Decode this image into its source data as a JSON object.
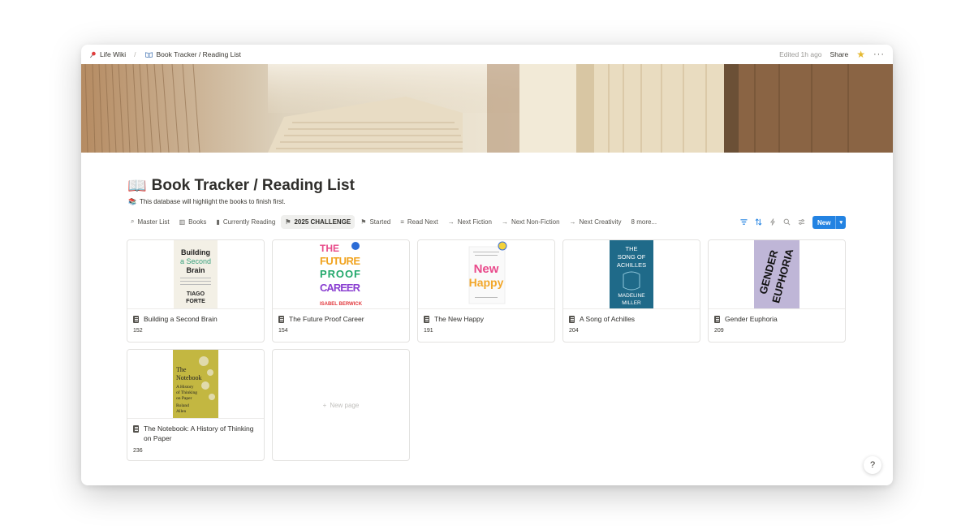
{
  "breadcrumb": {
    "items": [
      {
        "icon": "pin-icon",
        "label": "Life Wiki"
      },
      {
        "icon": "open-book-icon",
        "label": "Book Tracker / Reading List"
      }
    ]
  },
  "topbar": {
    "edited": "Edited 1h ago",
    "share": "Share"
  },
  "page": {
    "emoji": "📖",
    "title": "Book Tracker / Reading List",
    "description_emoji": "📚",
    "description": "This database will highlight the books to finish first."
  },
  "tabs": [
    {
      "icon": "binoculars-icon",
      "glyph": "⌕",
      "label": "Master List"
    },
    {
      "icon": "book-icon",
      "glyph": "▥",
      "label": "Books"
    },
    {
      "icon": "bookmark-icon",
      "glyph": "▮",
      "label": "Currently Reading"
    },
    {
      "icon": "checkered-flag-icon",
      "glyph": "⚑",
      "label": "2025 CHALLENGE",
      "active": true
    },
    {
      "icon": "checkered-flag-icon",
      "glyph": "⚑",
      "label": "Started"
    },
    {
      "icon": "stack-icon",
      "glyph": "≡",
      "label": "Read Next"
    },
    {
      "icon": "arrow-right-icon",
      "glyph": "→",
      "label": "Next Fiction"
    },
    {
      "icon": "arrow-right-icon",
      "glyph": "→",
      "label": "Next Non-Fiction"
    },
    {
      "icon": "arrow-right-icon",
      "glyph": "→",
      "label": "Next Creativity"
    },
    {
      "icon": "",
      "glyph": "",
      "label": "8 more..."
    }
  ],
  "toolbar": {
    "new_label": "New"
  },
  "books": [
    {
      "title": "Building a Second Brain",
      "pages": "152",
      "cover_lines": [
        "Building",
        "a Second",
        "Brain",
        "TIAGO",
        "FORTE"
      ]
    },
    {
      "title": "The Future Proof Career",
      "pages": "154",
      "cover_lines": [
        "THE",
        "FUTURE",
        "PROOF",
        "CAREER",
        "ISABEL BERWICK"
      ]
    },
    {
      "title": "The New Happy",
      "pages": "191",
      "cover_lines": [
        "New",
        "Happy"
      ]
    },
    {
      "title": "A Song of Achilles",
      "pages": "204",
      "cover_lines": [
        "THE",
        "SONG OF",
        "ACHILLES",
        "MADELINE",
        "MILLER"
      ]
    },
    {
      "title": "Gender Euphoria",
      "pages": "209",
      "cover_lines": [
        "GENDER",
        "EUPHORIA"
      ]
    },
    {
      "title": "The Notebook: A History of Thinking on Paper",
      "pages": "236",
      "cover_lines": [
        "The",
        "Notebook",
        "A History",
        "of Thinking",
        "on Paper",
        "Roland",
        "Allen"
      ]
    }
  ],
  "new_page": {
    "label": "New page"
  },
  "colors": {
    "accent": "#2383e2",
    "star": "#e5b931"
  }
}
